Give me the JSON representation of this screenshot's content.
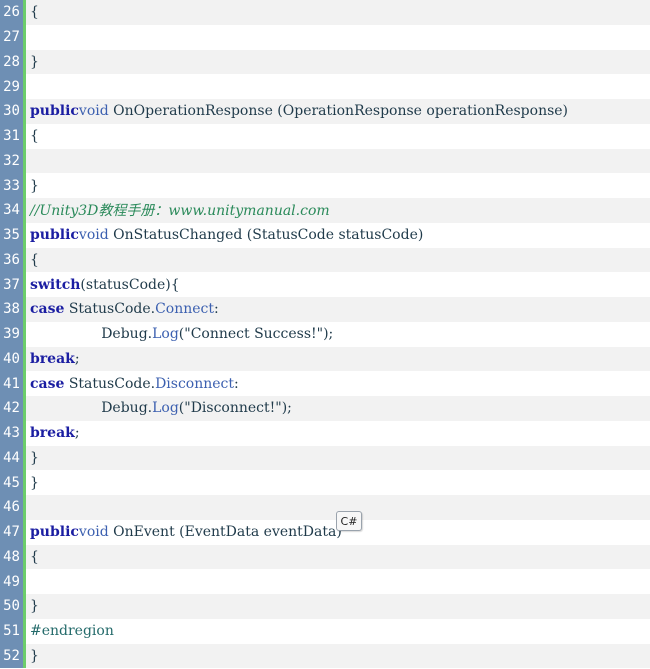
{
  "lines": [
    {
      "num": "26",
      "segments": [
        {
          "t": "{",
          "c": "plain"
        }
      ]
    },
    {
      "num": "27",
      "segments": []
    },
    {
      "num": "28",
      "segments": [
        {
          "t": "}",
          "c": "plain"
        }
      ]
    },
    {
      "num": "29",
      "segments": []
    },
    {
      "num": "30",
      "segments": [
        {
          "t": "public",
          "c": "kw"
        },
        {
          "t": "void",
          "c": "kwlight"
        },
        {
          "t": " OnOperationResponse (OperationResponse operationResponse)",
          "c": "plain"
        }
      ]
    },
    {
      "num": "31",
      "segments": [
        {
          "t": "{",
          "c": "plain"
        }
      ]
    },
    {
      "num": "32",
      "segments": []
    },
    {
      "num": "33",
      "segments": [
        {
          "t": "}",
          "c": "plain"
        }
      ]
    },
    {
      "num": "34",
      "segments": [
        {
          "t": "//Unity3D教程手册：www.unitymanual.com",
          "c": "comment"
        }
      ]
    },
    {
      "num": "35",
      "segments": [
        {
          "t": "public",
          "c": "kw"
        },
        {
          "t": "void",
          "c": "kwlight"
        },
        {
          "t": " OnStatusChanged (StatusCode statusCode)",
          "c": "plain"
        }
      ]
    },
    {
      "num": "36",
      "segments": [
        {
          "t": "{",
          "c": "plain"
        }
      ]
    },
    {
      "num": "37",
      "segments": [
        {
          "t": "switch",
          "c": "kw"
        },
        {
          "t": "(statusCode){",
          "c": "plain"
        }
      ]
    },
    {
      "num": "38",
      "segments": [
        {
          "t": "case",
          "c": "kw"
        },
        {
          "t": " StatusCode.",
          "c": "plain"
        },
        {
          "t": "Connect",
          "c": "kwlight"
        },
        {
          "t": ":",
          "c": "plain"
        }
      ]
    },
    {
      "num": "39",
      "segments": [
        {
          "t": "                Debug.",
          "c": "plain"
        },
        {
          "t": "Log",
          "c": "kwlight"
        },
        {
          "t": "(\"Connect Success!\");",
          "c": "plain"
        }
      ]
    },
    {
      "num": "40",
      "segments": [
        {
          "t": "break",
          "c": "kw"
        },
        {
          "t": ";",
          "c": "plain"
        }
      ]
    },
    {
      "num": "41",
      "segments": [
        {
          "t": "case",
          "c": "kw"
        },
        {
          "t": " StatusCode.",
          "c": "plain"
        },
        {
          "t": "Disconnect",
          "c": "kwlight"
        },
        {
          "t": ":",
          "c": "plain"
        }
      ]
    },
    {
      "num": "42",
      "segments": [
        {
          "t": "                Debug.",
          "c": "plain"
        },
        {
          "t": "Log",
          "c": "kwlight"
        },
        {
          "t": "(\"Disconnect!\");",
          "c": "plain"
        }
      ]
    },
    {
      "num": "43",
      "segments": [
        {
          "t": "break",
          "c": "kw"
        },
        {
          "t": ";",
          "c": "plain"
        }
      ]
    },
    {
      "num": "44",
      "segments": [
        {
          "t": "}",
          "c": "plain"
        }
      ]
    },
    {
      "num": "45",
      "segments": [
        {
          "t": "}",
          "c": "plain"
        }
      ]
    },
    {
      "num": "46",
      "segments": []
    },
    {
      "num": "47",
      "segments": [
        {
          "t": "public",
          "c": "kw"
        },
        {
          "t": "void",
          "c": "kwlight"
        },
        {
          "t": " OnEvent (EventData eventData)",
          "c": "plain"
        }
      ]
    },
    {
      "num": "48",
      "segments": [
        {
          "t": "{",
          "c": "plain"
        }
      ]
    },
    {
      "num": "49",
      "segments": []
    },
    {
      "num": "50",
      "segments": [
        {
          "t": "}",
          "c": "plain"
        }
      ]
    },
    {
      "num": "51",
      "segments": [
        {
          "t": "#endregion",
          "c": "dir"
        }
      ]
    },
    {
      "num": "52",
      "segments": [
        {
          "t": "}",
          "c": "plain"
        }
      ]
    }
  ],
  "tooltip": {
    "label": "C#"
  },
  "colors": {
    "gutter": "#6e8fb4",
    "gutter_border": "#6ccd6c",
    "keyword": "#1b1ea2",
    "type": "#3c60b0",
    "comment": "#2a8a5a"
  }
}
